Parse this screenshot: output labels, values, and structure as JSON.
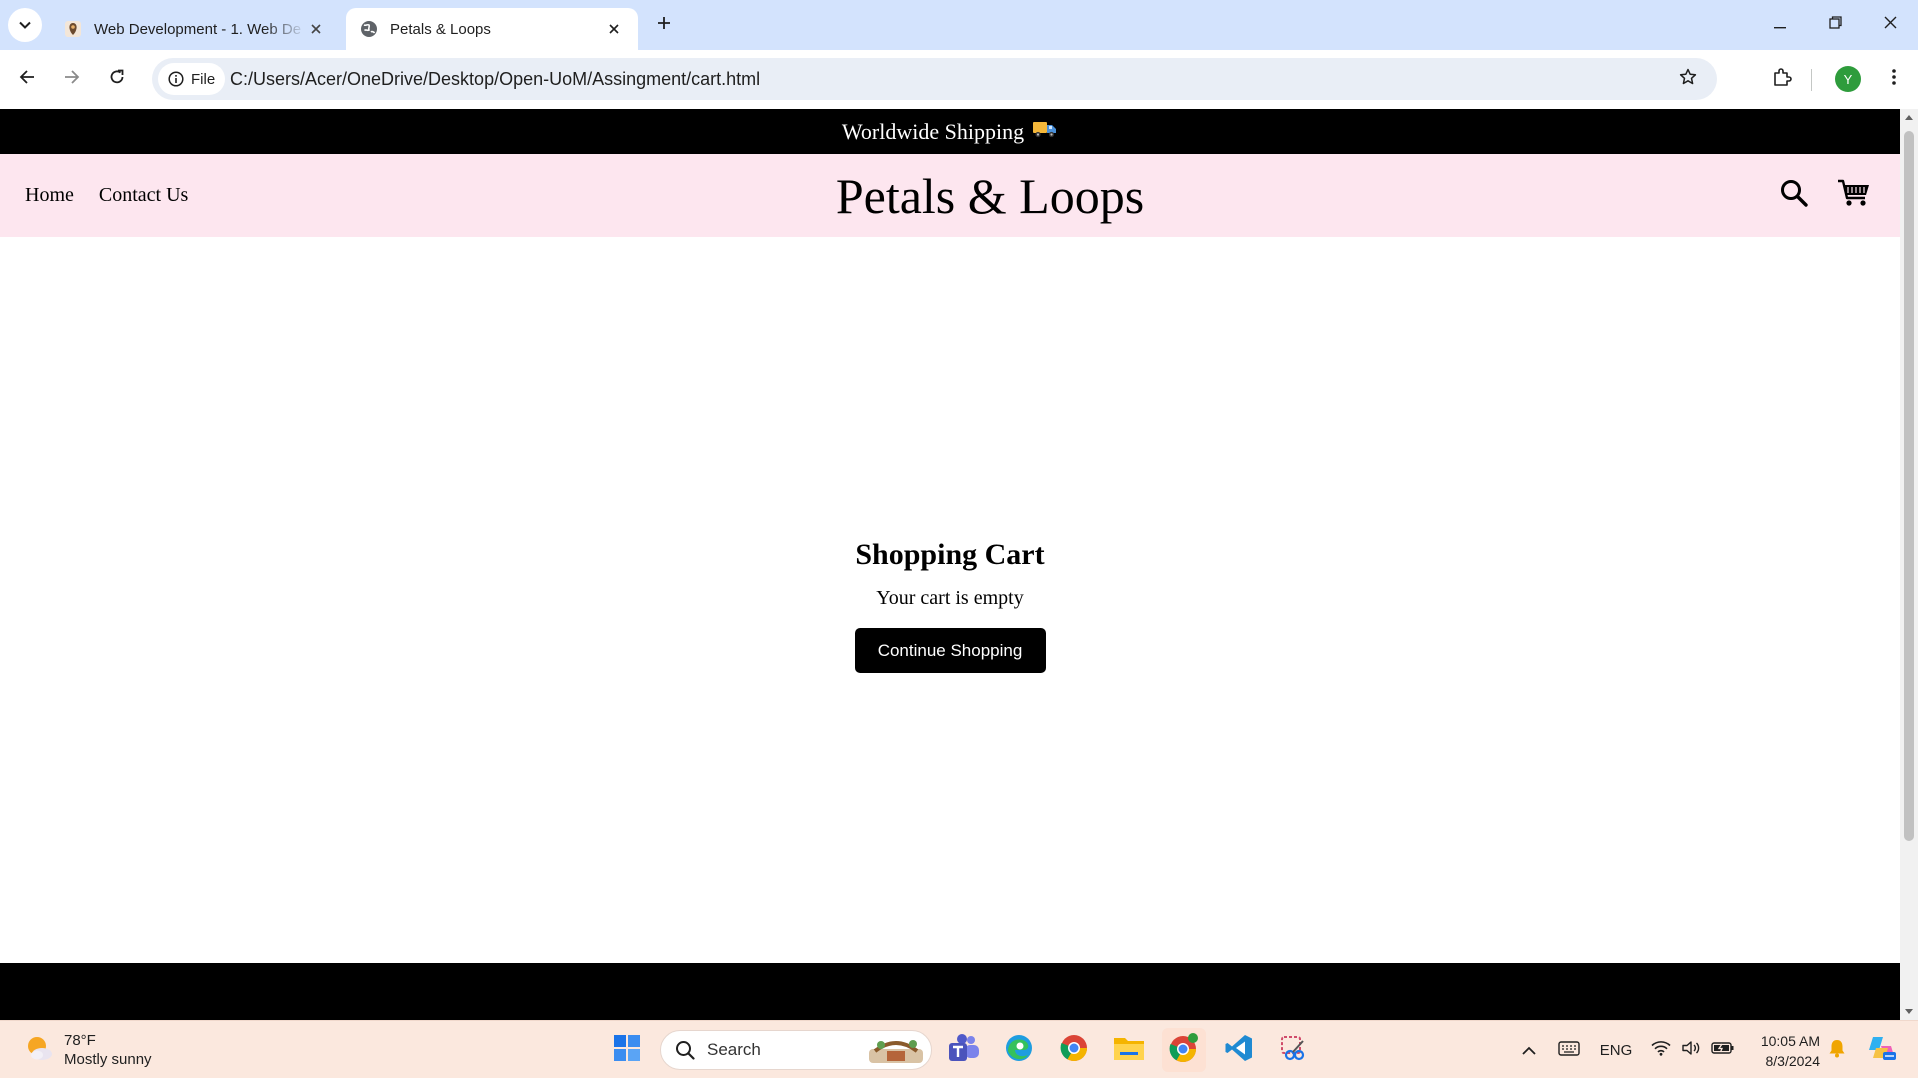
{
  "browser": {
    "tabs": [
      {
        "title": "Web Development - 1. Web De",
        "active": false
      },
      {
        "title": "Petals & Loops",
        "active": true
      }
    ],
    "site_chip_label": "File",
    "url": "C:/Users/Acer/OneDrive/Desktop/Open-UoM/Assingment/cart.html",
    "profile_initial": "Y"
  },
  "page": {
    "announcement": "Worldwide Shipping",
    "announcement_emoji": "🚚",
    "nav": [
      "Home",
      "Contact Us"
    ],
    "brand": "Petals & Loops",
    "cart": {
      "title": "Shopping Cart",
      "message": "Your cart is empty",
      "button": "Continue Shopping"
    }
  },
  "taskbar": {
    "weather_temp": "78°F",
    "weather_desc": "Mostly sunny",
    "search_placeholder": "Search",
    "language": "ENG",
    "time": "10:05 AM",
    "date": "8/3/2024"
  },
  "colors": {
    "tabstrip_bg": "#d3e3fd",
    "announce_bg": "#000000",
    "header_bg": "#fde6ef",
    "button_bg": "#000000",
    "taskbar_bg": "#fbe8de"
  }
}
